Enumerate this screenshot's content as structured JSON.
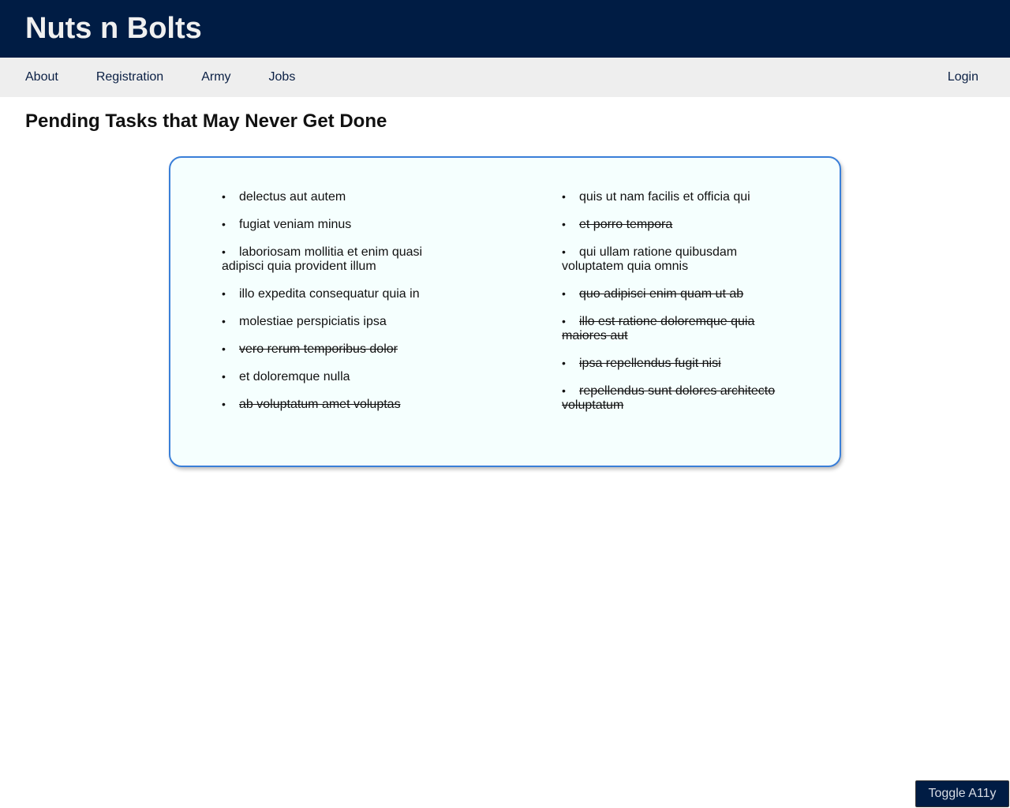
{
  "header": {
    "title": "Nuts n Bolts"
  },
  "nav": {
    "items": [
      "About",
      "Registration",
      "Army",
      "Jobs"
    ],
    "login": "Login"
  },
  "main": {
    "title": "Pending Tasks that May Never Get Done"
  },
  "tasks": {
    "left": [
      {
        "text": "delectus aut autem",
        "done": false
      },
      {
        "text": "fugiat veniam minus",
        "done": false
      },
      {
        "text": "laboriosam mollitia et enim quasi adipisci quia provident illum",
        "done": false
      },
      {
        "text": "illo expedita consequatur quia in",
        "done": false
      },
      {
        "text": "molestiae perspiciatis ipsa",
        "done": false
      },
      {
        "text": "vero rerum temporibus dolor",
        "done": true
      },
      {
        "text": "et doloremque nulla",
        "done": false
      },
      {
        "text": "ab voluptatum amet voluptas",
        "done": true
      }
    ],
    "right": [
      {
        "text": "quis ut nam facilis et officia qui",
        "done": false
      },
      {
        "text": "et porro tempora",
        "done": true
      },
      {
        "text": "qui ullam ratione quibusdam voluptatem quia omnis",
        "done": false
      },
      {
        "text": "quo adipisci enim quam ut ab",
        "done": true
      },
      {
        "text": "illo est ratione doloremque quia maiores aut",
        "done": true
      },
      {
        "text": "ipsa repellendus fugit nisi",
        "done": true
      },
      {
        "text": "repellendus sunt dolores architecto voluptatum",
        "done": true
      }
    ]
  },
  "footer": {
    "toggle_label": "Toggle A11y"
  }
}
